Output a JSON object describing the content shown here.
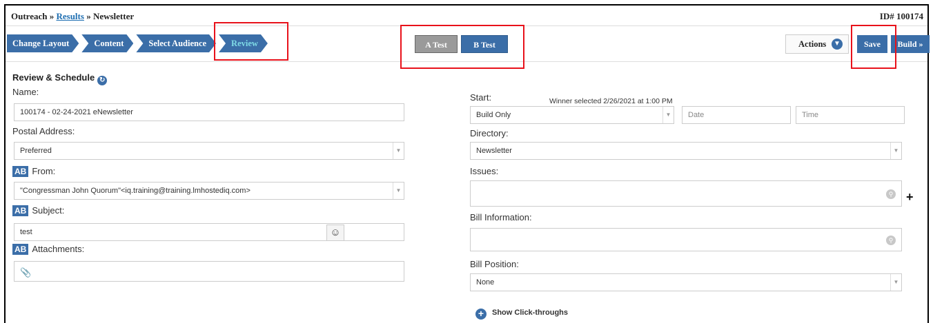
{
  "breadcrumb": {
    "root": "Outreach",
    "sep1": "»",
    "link": "Results",
    "sep2": "»",
    "current": "Newsletter"
  },
  "record_id": "ID# 100174",
  "steps": [
    {
      "label": "Change Layout"
    },
    {
      "label": "Content"
    },
    {
      "label": "Select Audience"
    },
    {
      "label": "Review"
    }
  ],
  "ab_tests": {
    "a_label": "A Test",
    "b_label": "B Test"
  },
  "actions": {
    "label": "Actions",
    "icon": "chevron-down-icon"
  },
  "save_label": "Save",
  "build_label": "Build »",
  "section": {
    "title": "Review & Schedule",
    "icon": "refresh-icon"
  },
  "left": {
    "name_label": "Name:",
    "name_value": "100174 - 02-24-2021 eNewsletter",
    "postal_label": "Postal Address:",
    "postal_value": "Preferred",
    "ab_badge": "AB",
    "from_label": "From:",
    "from_value": "\"Congressman John Quorum\"<iq.training@training.lmhostediq.com>",
    "subject_label": "Subject:",
    "subject_value": "test",
    "attachments_label": "Attachments:"
  },
  "right": {
    "start_label": "Start:",
    "winner_text": "Winner selected 2/26/2021 at 1:00 PM",
    "start_value": "Build Only",
    "date_placeholder": "Date",
    "time_placeholder": "Time",
    "directory_label": "Directory:",
    "directory_value": "Newsletter",
    "issues_label": "Issues:",
    "bill_info_label": "Bill Information:",
    "bill_position_label": "Bill Position:",
    "bill_position_value": "None",
    "show_click_label": "Show Click-throughs"
  },
  "colors": {
    "accent": "#3b6ea8",
    "active_step_text": "#7fdbe6",
    "highlight": "#e8111a",
    "a_test_bg": "#9a9a9a"
  }
}
